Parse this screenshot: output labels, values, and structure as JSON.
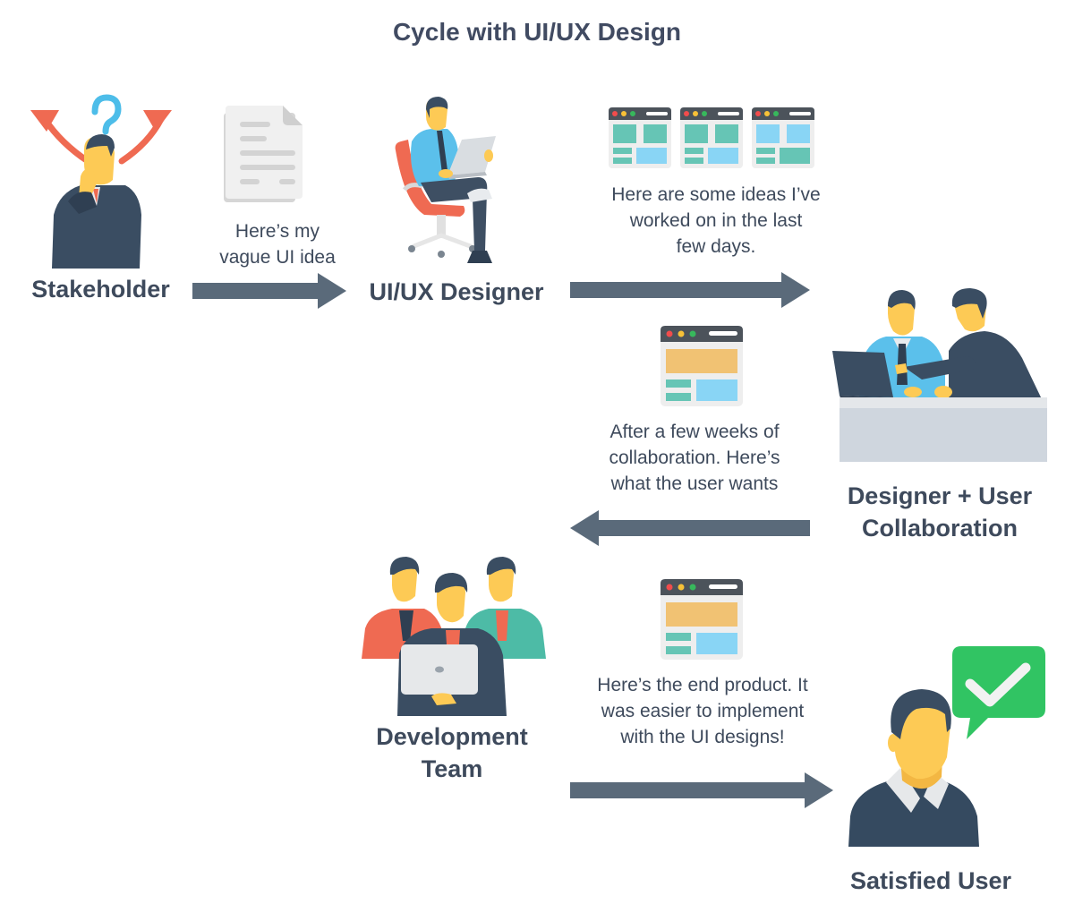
{
  "title": "Cycle with UI/UX Design",
  "colors": {
    "text": "#3e4a5c",
    "arrow": "#5a6a7a",
    "navy": "#3a4d62",
    "skin": "#fdca55",
    "accent_red": "#ef6a52",
    "question_blue": "#4dbde9",
    "teal": "#66c5b5",
    "light_blue": "#89d5f5",
    "orange_block": "#f1c273",
    "check_green": "#31c463"
  },
  "nodes": {
    "stakeholder": {
      "label": "Stakeholder"
    },
    "designer": {
      "label": "UI/UX Designer"
    },
    "collaboration": {
      "label_line1": "Designer + User",
      "label_line2": "Collaboration"
    },
    "dev_team": {
      "label_line1": "Development",
      "label_line2": "Team"
    },
    "satisfied_user": {
      "label": "Satisfied User"
    }
  },
  "edges": [
    {
      "from": "stakeholder",
      "to": "designer",
      "direction": "right",
      "caption_lines": [
        "Here’s my",
        "vague UI idea"
      ],
      "icon": "document-icon"
    },
    {
      "from": "designer",
      "to": "collaboration",
      "direction": "right",
      "caption_lines": [
        "Here are some ideas I’ve",
        "worked on in the last",
        "few days."
      ],
      "icon": "three-wireframes-icon"
    },
    {
      "from": "collaboration",
      "to": "dev_team",
      "direction": "left",
      "caption_lines": [
        "After a few weeks of",
        "collaboration. Here’s",
        "what the user wants"
      ],
      "icon": "wireframe-icon"
    },
    {
      "from": "dev_team",
      "to": "satisfied_user",
      "direction": "right",
      "caption_lines": [
        "Here’s the end product. It",
        "was easier to implement",
        "with the UI designs!"
      ],
      "icon": "wireframe-icon"
    }
  ]
}
